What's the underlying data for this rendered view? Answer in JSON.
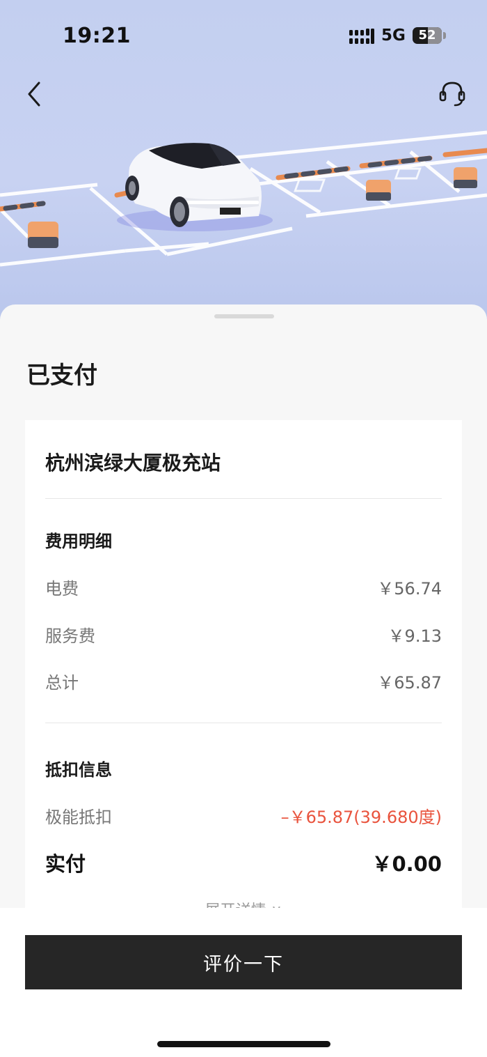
{
  "status_bar": {
    "time": "19:21",
    "network": "5G",
    "battery": "52"
  },
  "header": {
    "back_icon": "chevron-left-icon",
    "support_icon": "headset-icon"
  },
  "order": {
    "status_title": "已支付",
    "station_name": "杭州滨绿大厦极充站",
    "fee_section": {
      "title": "费用明细",
      "rows": [
        {
          "label": "电费",
          "value": "￥56.74"
        },
        {
          "label": "服务费",
          "value": "￥9.13"
        },
        {
          "label": "总计",
          "value": "￥65.87"
        }
      ]
    },
    "deduction_section": {
      "title": "抵扣信息",
      "rows": [
        {
          "label": "极能抵扣",
          "value": "–￥65.87(39.680度)"
        }
      ]
    },
    "actual_pay": {
      "label": "实付",
      "value": "￥0.00"
    },
    "expand_label": "展开详情 ∨"
  },
  "actions": {
    "rate_button": "评价一下"
  },
  "colors": {
    "accent_red": "#e9533d",
    "button_dark": "#262626",
    "hero_bg": "#c3cff0"
  }
}
